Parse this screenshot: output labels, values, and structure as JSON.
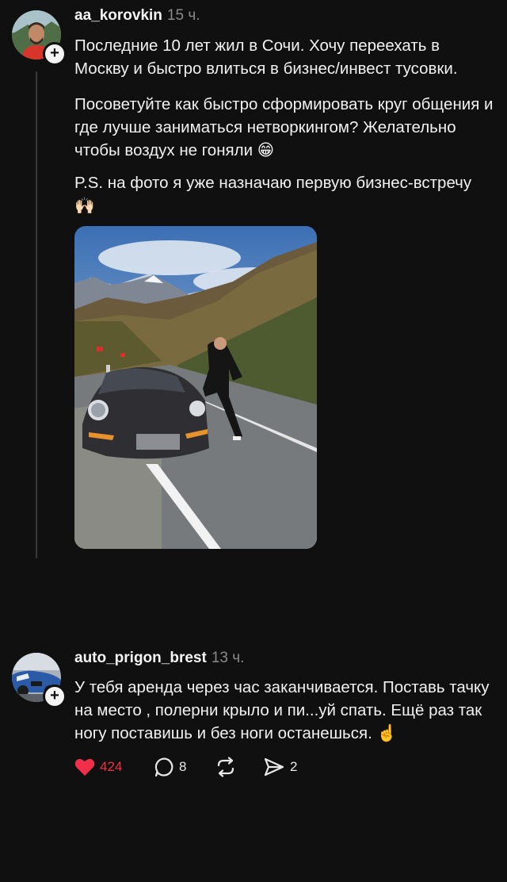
{
  "post": {
    "username": "aa_korovkin",
    "time": "15 ч.",
    "paragraph1": "Последние 10 лет жил в Сочи. Хочу переехать в Москву и быстро влиться в бизнес/инвест тусовки.",
    "paragraph2": "Посоветуйте как быстро сформировать круг общения и где лучше заниматься нетворкингом? Желательно чтобы воздух не гоняли 😁",
    "paragraph3": "P.S. на фото я уже назначаю первую бизнес-встречу 🙌🏻",
    "follow_symbol": "+"
  },
  "reply": {
    "username": "auto_prigon_brest",
    "time": "13 ч.",
    "text": "У тебя аренда через час заканчивается. Поставь тачку на место , полерни крыло и пи...уй спать. Ещё раз так ногу поставишь и без ноги останешься. ☝️",
    "follow_symbol": "+",
    "likes": "424",
    "replies": "8",
    "shares": "2"
  },
  "colors": {
    "background": "#101010",
    "like_red": "#f03048",
    "time_gray": "#8a8a8a"
  },
  "icons": [
    "heart-icon",
    "comment-icon",
    "repost-icon",
    "share-icon",
    "plus-icon"
  ]
}
